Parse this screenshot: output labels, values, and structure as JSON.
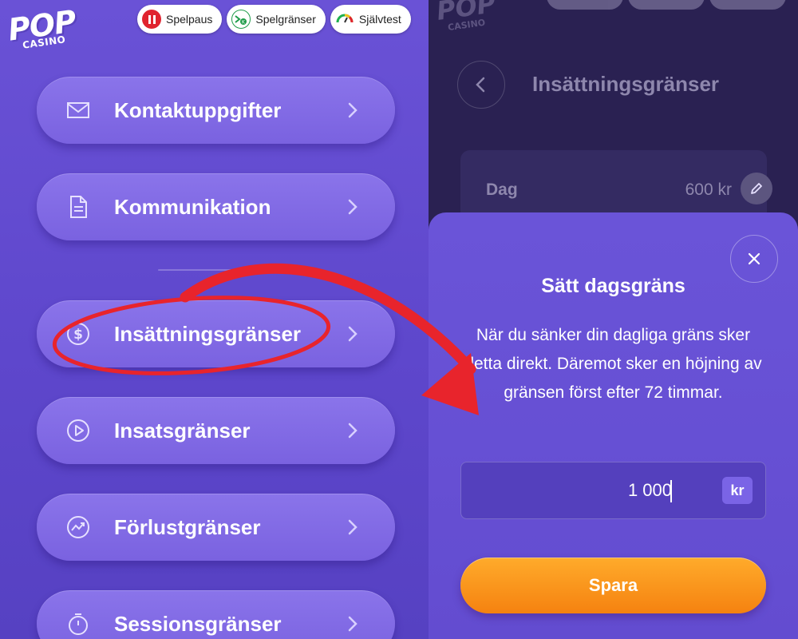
{
  "brand": {
    "logo_main": "POP",
    "logo_sub": "CASINO"
  },
  "top_pills": [
    {
      "label": "Spelpaus",
      "icon": "pause-icon"
    },
    {
      "label": "Spelgränser",
      "icon": "limits-icon"
    },
    {
      "label": "Självtest",
      "icon": "gauge-icon"
    }
  ],
  "menu": {
    "items": [
      {
        "label": "Kontaktuppgifter",
        "icon": "envelope-icon"
      },
      {
        "label": "Kommunikation",
        "icon": "document-icon"
      },
      {
        "label": "Insättningsgränser",
        "icon": "dollar-coin-icon"
      },
      {
        "label": "Insatsgränser",
        "icon": "play-circle-icon"
      },
      {
        "label": "Förlustgränser",
        "icon": "trend-down-icon"
      },
      {
        "label": "Sessionsgränser",
        "icon": "stopwatch-icon"
      }
    ]
  },
  "detail": {
    "title": "Insättningsgränser",
    "day_label": "Dag",
    "day_value": "600 kr"
  },
  "dialog": {
    "title": "Sätt dagsgräns",
    "description": "När du sänker din dagliga gräns sker detta direkt. Däremot sker en höjning av gränsen först efter 72 timmar.",
    "amount_value": "1 000",
    "amount_unit": "kr",
    "save_label": "Spara"
  },
  "colors": {
    "panel_purple": "#6a52d6",
    "button_orange": "#f58210",
    "annotation_red": "#e8242c",
    "dark_bg": "#2a2152"
  }
}
